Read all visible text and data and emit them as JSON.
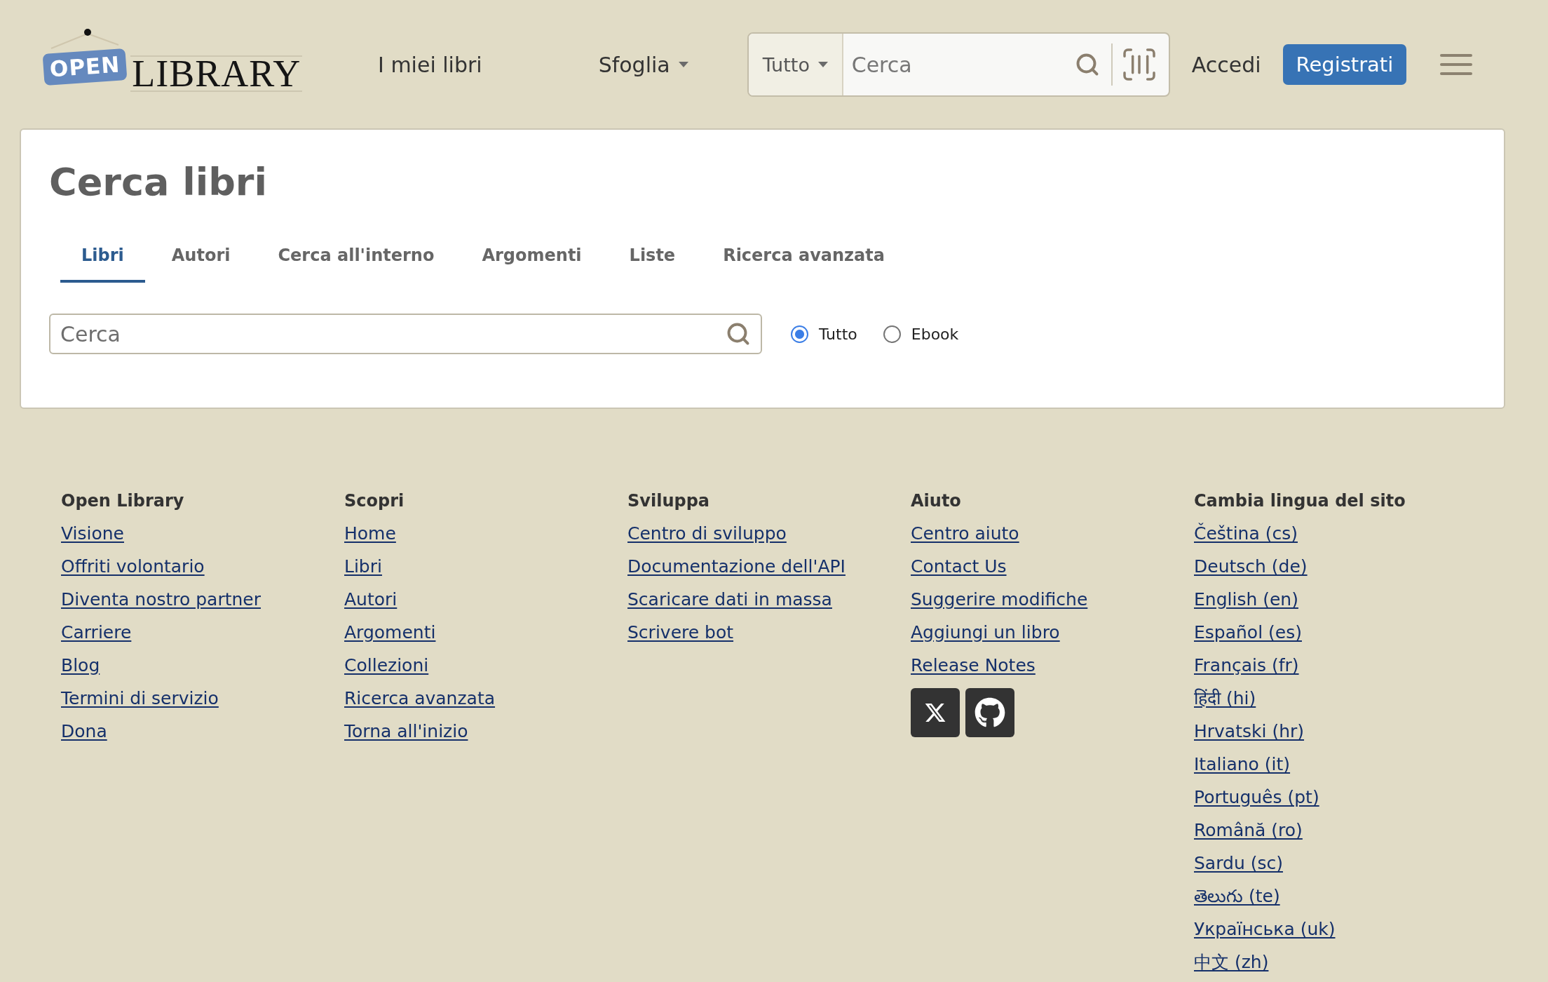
{
  "header": {
    "logo": {
      "sign": "OPEN",
      "wordmark": "LIBRARY"
    },
    "nav": [
      {
        "label": "I miei libri",
        "kind": "link"
      },
      {
        "label": "Sfoglia",
        "kind": "dropdown"
      }
    ],
    "search": {
      "scope": "Tutto",
      "placeholder": "Cerca"
    },
    "login": "Accedi",
    "signup": "Registrati"
  },
  "search_page": {
    "title": "Cerca libri",
    "tabs": [
      {
        "label": "Libri",
        "selected": true
      },
      {
        "label": "Autori",
        "selected": false
      },
      {
        "label": "Cerca all'interno",
        "selected": false
      },
      {
        "label": "Argomenti",
        "selected": false
      },
      {
        "label": "Liste",
        "selected": false
      },
      {
        "label": "Ricerca avanzata",
        "selected": false
      }
    ],
    "search": {
      "placeholder": "Cerca"
    },
    "modes": [
      {
        "label": "Tutto",
        "selected": true
      },
      {
        "label": "Ebook",
        "selected": false
      }
    ]
  },
  "footer": {
    "columns": [
      {
        "heading": "Open Library",
        "links": [
          "Visione",
          "Offriti volontario",
          "Diventa nostro partner",
          "Carriere",
          "Blog",
          "Termini di servizio",
          "Dona"
        ]
      },
      {
        "heading": "Scopri",
        "links": [
          "Home",
          "Libri",
          "Autori",
          "Argomenti",
          "Collezioni",
          "Ricerca avanzata",
          "Torna all'inizio"
        ]
      },
      {
        "heading": "Sviluppa",
        "links": [
          "Centro di sviluppo",
          "Documentazione dell'API",
          "Scaricare dati in massa",
          "Scrivere bot"
        ]
      },
      {
        "heading": "Aiuto",
        "links": [
          "Centro aiuto",
          "Contact Us",
          "Suggerire modifiche",
          "Aggiungi un libro",
          "Release Notes"
        ],
        "social_links": [
          {
            "kind": "x"
          },
          {
            "kind": "github"
          }
        ]
      },
      {
        "heading": "Cambia lingua del sito",
        "links": [
          "Čeština (cs)",
          "Deutsch (de)",
          "English (en)",
          "Español (es)",
          "Français (fr)",
          "हिंदी (hi)",
          "Hrvatski (hr)",
          "Italiano (it)",
          "Português (pt)",
          "Română (ro)",
          "Sardu (sc)",
          "తెలుగు (te)",
          "Українська (uk)",
          "中文 (zh)"
        ]
      }
    ]
  }
}
